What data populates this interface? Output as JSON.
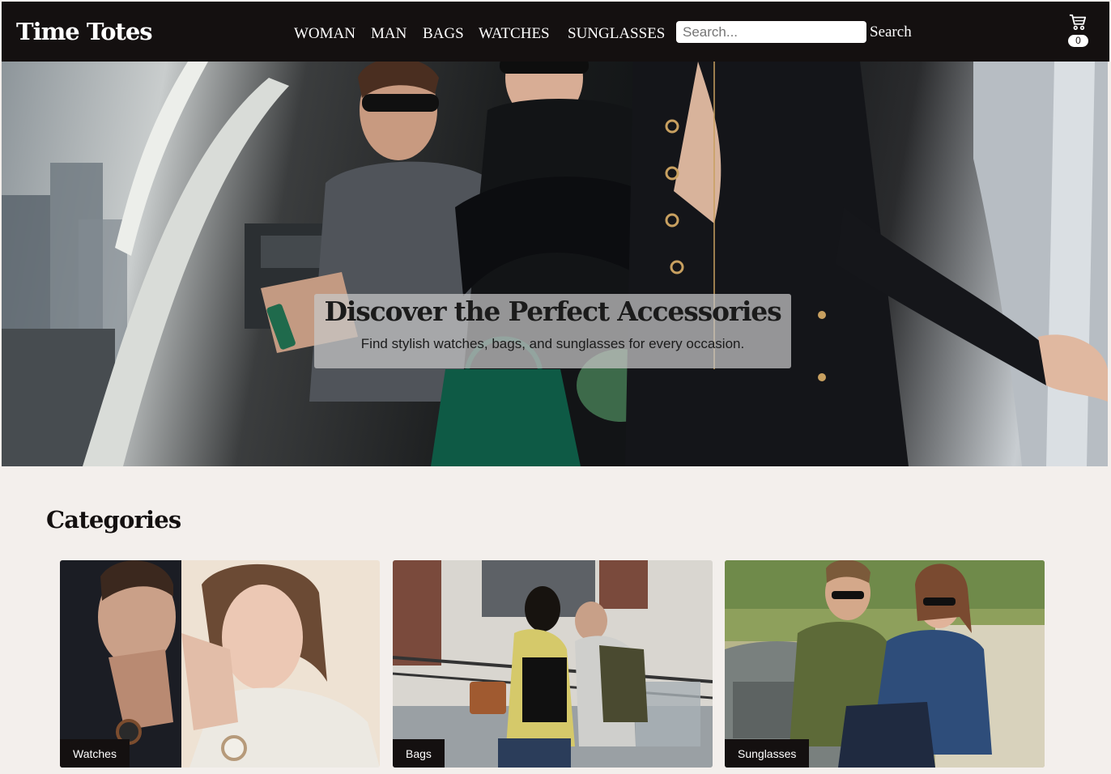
{
  "brand": {
    "name": "Time Totes"
  },
  "nav": {
    "items": [
      {
        "label": "WOMAN"
      },
      {
        "label": "MAN"
      },
      {
        "label": "BAGS"
      },
      {
        "label": "WATCHES"
      },
      {
        "label": "SUNGLASSES"
      }
    ]
  },
  "search": {
    "placeholder": "Search...",
    "value": "",
    "button_label": "Search"
  },
  "cart": {
    "icon": "cart-icon",
    "count": "0"
  },
  "hero": {
    "title": "Discover the Perfect Accessories",
    "subtitle": "Find stylish watches, bags, and sunglasses for every occasion."
  },
  "categories": {
    "title": "Categories",
    "items": [
      {
        "label": "Watches"
      },
      {
        "label": "Bags"
      },
      {
        "label": "Sunglasses"
      }
    ]
  },
  "colors": {
    "header_bg": "#141010",
    "page_bg": "#f3efec",
    "accent_green": "#0e5a45"
  }
}
